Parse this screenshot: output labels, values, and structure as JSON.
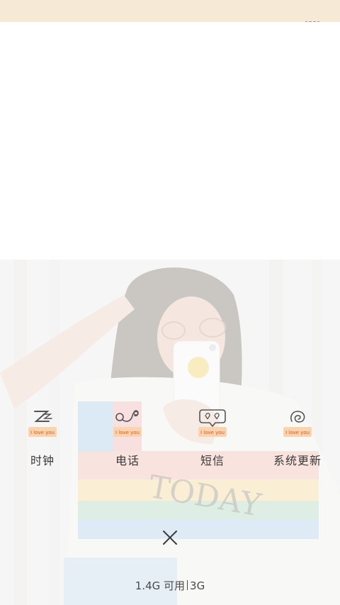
{
  "status_bar": {
    "color": "#f6ead7"
  },
  "overview": {
    "icon": "recents-icon"
  },
  "shortcuts": [
    {
      "label": "时钟",
      "icon": "clock-doodle-icon",
      "badge": "I love you"
    },
    {
      "label": "电话",
      "icon": "phone-doodle-icon",
      "badge": "I love you"
    },
    {
      "label": "短信",
      "icon": "message-doodle-icon",
      "badge": "I love you"
    },
    {
      "label": "系统更新",
      "icon": "update-doodle-icon",
      "badge": "I love you"
    }
  ],
  "close": {
    "icon": "close-icon"
  },
  "memory": {
    "available": "1.4G 可用",
    "total": "3G"
  },
  "colors": {
    "badge": "#f29a4a",
    "text": "#3a3a3a"
  }
}
